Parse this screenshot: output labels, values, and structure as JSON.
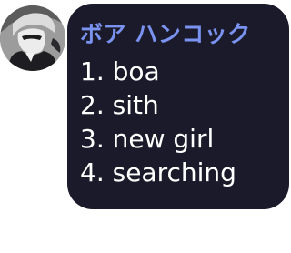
{
  "message": {
    "sender_name": "ボア ハンコック",
    "avatar_icon": "user-avatar-icon",
    "lines": [
      "1. boa",
      "2. sith",
      "3. new girl",
      "4. searching"
    ]
  },
  "colors": {
    "bubble_background": "#1b1a2b",
    "sender_name": "#7b93f0",
    "message_text": "#ffffff",
    "page_background": "#ffffff"
  }
}
